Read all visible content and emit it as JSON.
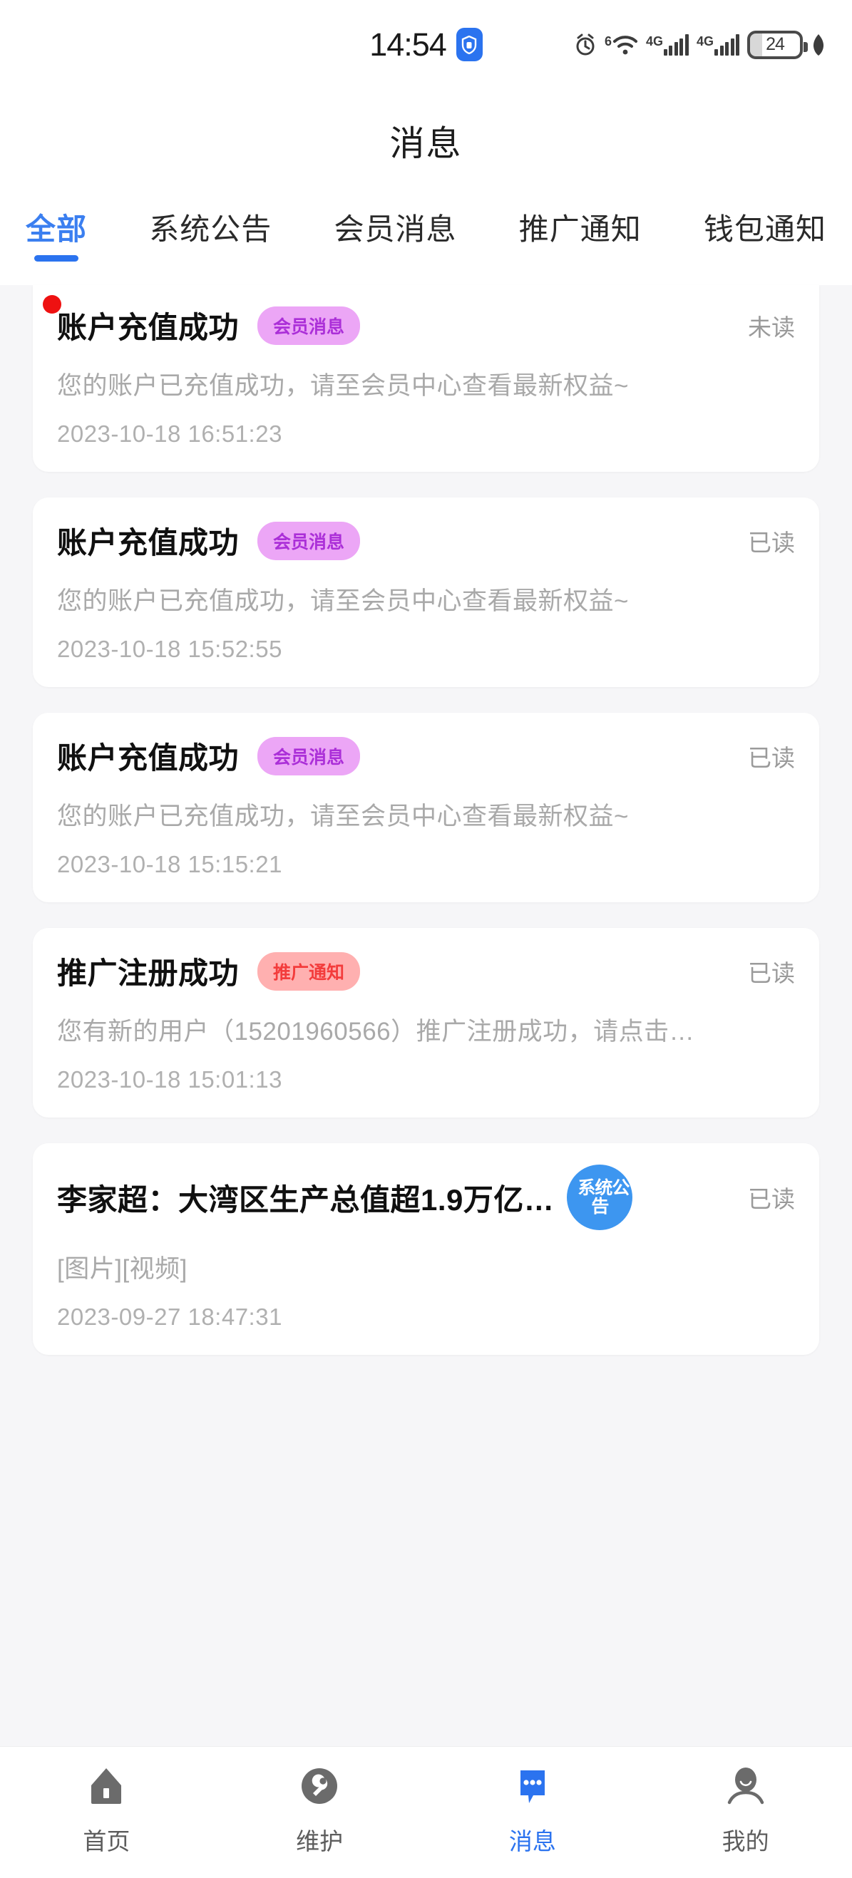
{
  "statusbar": {
    "time": "14:54",
    "app_badge_icon": "app-shield-icon",
    "alarm_icon": "alarm-icon",
    "wifi_icon": "wifi6-icon",
    "wifi_generation": "6",
    "signal1_label": "4G",
    "signal2_label": "4G",
    "battery_level": "24",
    "power_saving_icon": "leaf-icon"
  },
  "header": {
    "title": "消息"
  },
  "tabs": [
    {
      "label": "全部",
      "active": true
    },
    {
      "label": "系统公告",
      "active": false
    },
    {
      "label": "会员消息",
      "active": false
    },
    {
      "label": "推广通知",
      "active": false
    },
    {
      "label": "钱包通知",
      "active": false
    }
  ],
  "messages": [
    {
      "title": "账户充值成功",
      "badge": "会员消息",
      "badge_type": "member",
      "status": "未读",
      "unread": true,
      "body": "您的账户已充值成功，请至会员中心查看最新权益~",
      "time": "2023-10-18 16:51:23"
    },
    {
      "title": "账户充值成功",
      "badge": "会员消息",
      "badge_type": "member",
      "status": "已读",
      "unread": false,
      "body": "您的账户已充值成功，请至会员中心查看最新权益~",
      "time": "2023-10-18 15:52:55"
    },
    {
      "title": "账户充值成功",
      "badge": "会员消息",
      "badge_type": "member",
      "status": "已读",
      "unread": false,
      "body": "您的账户已充值成功，请至会员中心查看最新权益~",
      "time": "2023-10-18 15:15:21"
    },
    {
      "title": "推广注册成功",
      "badge": "推广通知",
      "badge_type": "promo",
      "status": "已读",
      "unread": false,
      "body": "您有新的用户（15201960566）推广注册成功，请点击…",
      "time": "2023-10-18 15:01:13"
    },
    {
      "title": "李家超：大湾区生产总值超1.9万亿…",
      "badge": "系统公告",
      "badge_line1": "系统公",
      "badge_line2": "告",
      "badge_type": "system",
      "status": "已读",
      "unread": false,
      "body": "[图片][视频]",
      "time": "2023-09-27 18:47:31"
    }
  ],
  "bottomnav": [
    {
      "label": "首页",
      "icon": "home-icon",
      "active": false
    },
    {
      "label": "维护",
      "icon": "wrench-icon",
      "active": false
    },
    {
      "label": "消息",
      "icon": "message-bubble-icon",
      "active": true
    },
    {
      "label": "我的",
      "icon": "person-icon",
      "active": false
    }
  ],
  "colors": {
    "accent": "#2b73ef",
    "badge_member_bg": "#eca6f6",
    "badge_member_text": "#ab2fd8",
    "badge_promo_bg": "#ffb0b0",
    "badge_promo_text": "#f33c3c",
    "badge_system_bg": "#3d96f0",
    "unread_dot": "#ee1111",
    "page_bg": "#f6f6f8"
  }
}
